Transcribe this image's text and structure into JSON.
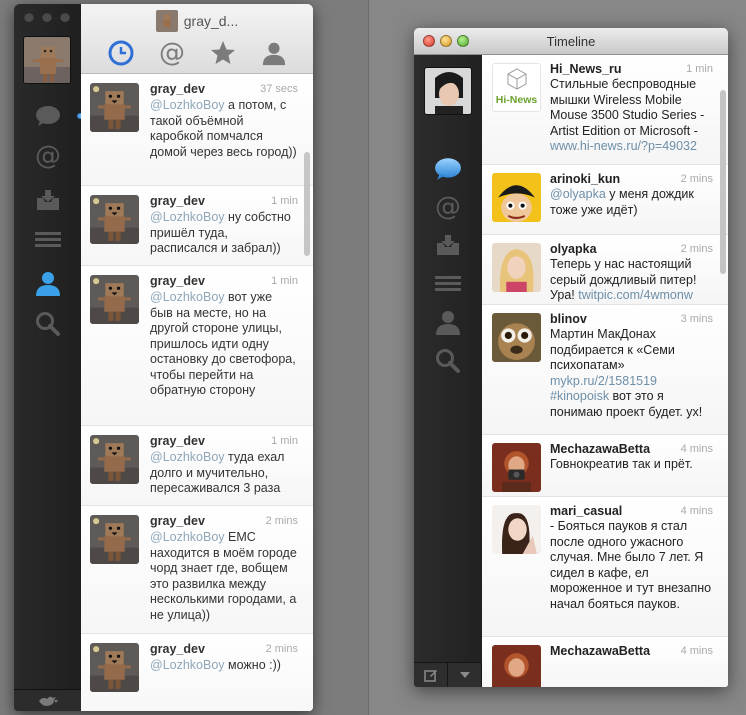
{
  "colors": {
    "accent": "#2f6fd6",
    "active_nav": "#3aa0e8",
    "link": "#6d8fa9",
    "mention": "#8fa7b9"
  },
  "window1": {
    "header": {
      "title": "gray_d..."
    },
    "tabs": [
      {
        "icon": "clock-icon",
        "active": true
      },
      {
        "icon": "at-icon",
        "active": false
      },
      {
        "icon": "star-icon",
        "active": false
      },
      {
        "icon": "person-icon",
        "active": false
      }
    ],
    "sidebar": [
      "speech-bubble-icon",
      "at-icon",
      "inbox-icon",
      "list-icon",
      "person-icon",
      "search-icon"
    ],
    "tweets": [
      {
        "user": "gray_dev",
        "time": "37 secs",
        "mention": "@LozhkoBoy",
        "text": " а потом, с такой объёмной каробкой помчался домой через весь город))"
      },
      {
        "user": "gray_dev",
        "time": "1 min",
        "mention": "@LozhkoBoy",
        "text": " ну собстно пришёл туда, расписался и забрал))"
      },
      {
        "user": "gray_dev",
        "time": "1 min",
        "mention": "@LozhkoBoy",
        "text": " вот уже быв на месте, но на другой стороне улицы, пришлось идти одну остановку до светофора, чтобы перейти на обратную сторону"
      },
      {
        "user": "gray_dev",
        "time": "1 min",
        "mention": "@LozhkoBoy",
        "text": " туда ехал долго и мучительно, пересаживался 3 раза"
      },
      {
        "user": "gray_dev",
        "time": "2 mins",
        "mention": "@LozhkoBoy",
        "text": " ЕМС находится в моём городе чорд знает где, вобщем это развилка между несколькими городами, а не улица))"
      },
      {
        "user": "gray_dev",
        "time": "2 mins",
        "mention": "@LozhkoBoy",
        "text": " можно :))"
      }
    ]
  },
  "window2": {
    "title": "Timeline",
    "tweets": [
      {
        "user": "Hi_News_ru",
        "time": "1 min",
        "avatar_text": "Hi-News",
        "pre": "Стильные беспроводные мышки Wireless Mobile Mouse 3500 Studio Series - Artist Edition от Microsoft  - ",
        "link": "www.hi-news.ru/?p=49032",
        "post": ""
      },
      {
        "user": "arinoki_kun",
        "time": "2 mins",
        "pre": "",
        "link": "@olyapka",
        "post": " у меня дождик тоже уже идёт)"
      },
      {
        "user": "olyapka",
        "time": "2 mins",
        "pre": "Теперь у нас настоящий серый дождливый питер! Ура! ",
        "link": "twitpic.com/4wmonw",
        "post": ""
      },
      {
        "user": "blinov",
        "time": "3 mins",
        "pre": "Мартин МакДонах подбирается к «Семи психопатам» ",
        "link": "mykp.ru/2/1581519 #kinopoisk",
        "post": " вот это я понимаю проект будет. ух!"
      },
      {
        "user": "MechazawaBetta",
        "time": "4 mins",
        "pre": "Говнокреатив так и прёт.",
        "link": "",
        "post": ""
      },
      {
        "user": "mari_casual",
        "time": "4 mins",
        "pre": "- Бояться пауков я стал после одного ужасного случая. Мне было 7 лет. Я сидел в кафе, ел мороженное и тут внезапно начал бояться пауков.",
        "link": "",
        "post": ""
      },
      {
        "user": "MechazawaBetta",
        "time": "4 mins",
        "pre": "",
        "link": "",
        "post": ""
      }
    ]
  }
}
